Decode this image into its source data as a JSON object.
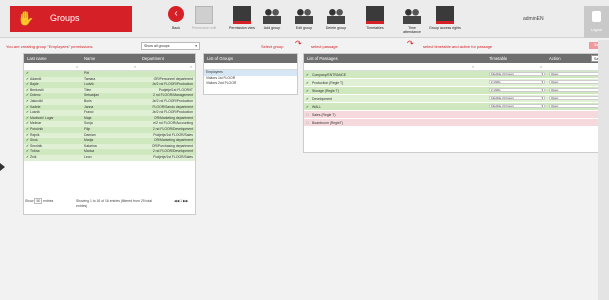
{
  "app": {
    "title": "Groups",
    "user": "adminEN",
    "logout": "Logout"
  },
  "toolbar": [
    {
      "name": "back-button",
      "label": "Back",
      "icon": "back-arrow-icon",
      "disabled": false
    },
    {
      "name": "permission-edit-button",
      "label": "Permission edit",
      "icon": "permission-edit-icon",
      "disabled": true
    },
    {
      "name": "permission-view-button",
      "label": "Permission view",
      "icon": "permission-view-icon",
      "disabled": false
    },
    {
      "name": "add-group-button",
      "label": "Add group",
      "icon": "add-group-icon",
      "disabled": false
    },
    {
      "name": "edit-group-button",
      "label": "Edit group",
      "icon": "edit-group-icon",
      "disabled": false
    },
    {
      "name": "delete-group-button",
      "label": "Delete group",
      "icon": "delete-group-icon",
      "disabled": false
    },
    {
      "name": "timetables-button",
      "label": "Timetables",
      "icon": "timetables-icon",
      "disabled": false
    },
    {
      "name": "time-attendance-button",
      "label": "Time attendance",
      "icon": "time-attendance-icon",
      "disabled": false
    },
    {
      "name": "group-access-rights-button",
      "label": "Group access rights",
      "icon": "group-access-rights-icon",
      "disabled": false
    }
  ],
  "hints": {
    "editing": "You are creating group \"Employees\" permissions",
    "select_group": "Select group",
    "select_passage": "select passage",
    "select_timetable": "select timetable and active for passage"
  },
  "show_groups": {
    "value": "Show all groups"
  },
  "save_label": "Save",
  "people": {
    "headers": [
      "Last name",
      "Name",
      "Department"
    ],
    "rows": [
      [
        "",
        "Pitt",
        ""
      ],
      [
        "Adamič",
        "Tamara",
        "OR/Personnel department"
      ],
      [
        "Bajde",
        "Ludvik",
        "Je/2 nd FLOOR/Production"
      ],
      [
        "Benkovič",
        "Tilen",
        "Podjetje/1st FLOOR/IT"
      ],
      [
        "Dolenc",
        "Sebastjan",
        "2 nd FLOOR/Management"
      ],
      [
        "Jakovčič",
        "Boris",
        "Je/2 nd FLOOR/Production"
      ],
      [
        "Kadele",
        "Janna",
        "FLOOR/Sandu department"
      ],
      [
        "Lusnik",
        "Franci",
        "Je/2 nd FLOOR/Production"
      ],
      [
        "Mariborič Logar",
        "Maja",
        "OR/Marketing department"
      ],
      [
        "Mežnar",
        "Sonja",
        "e/2 nd FLOOR/Accounting"
      ],
      [
        "Potočnik",
        "Filip",
        "2 nd FLOOR/Development"
      ],
      [
        "Rajnik",
        "Damian",
        "Podjetje/1st FLOOR/Sales"
      ],
      [
        "Sirok",
        "Marija",
        "OR/Marketing department"
      ],
      [
        "Smolnik",
        "Katarina",
        "OR/Purchasing department"
      ],
      [
        "Trdina",
        "Marica",
        "2 nd FLOOR/Development"
      ],
      [
        "Žnik",
        "Leon",
        "Podjetje/1st FLOOR/Sales"
      ]
    ],
    "show_label": "Show",
    "entries_value": "50",
    "entries_label": "entries",
    "info": "Showing 1 to 16 of 16 entries (filtered from 29 total entries)",
    "pager": "◀◀ 1 ▶▶"
  },
  "groups": {
    "header": "List of Groups",
    "items": [
      "Employees",
      "Visitors 1st FLOOR",
      "Visitors 2nd FLOOR"
    ]
  },
  "passages": {
    "headers": [
      "List of Passages",
      "Timetable",
      "Action"
    ],
    "rows": [
      {
        "name": "Company/ENTRANCE",
        "timetable": "Flexible 24 hours",
        "action": "Open",
        "state": "on"
      },
      {
        "name": "Production (Regle T)",
        "timetable": "2 shifts",
        "action": "Open",
        "state": "on"
      },
      {
        "name": "Storage (Regle T)",
        "timetable": "2 shifts",
        "action": "Open",
        "state": "on"
      },
      {
        "name": "Development",
        "timetable": "Flexible 24 hours",
        "action": "Open",
        "state": "on"
      },
      {
        "name": "WALL",
        "timetable": "Flexible 24 hours",
        "action": "Open",
        "state": "on"
      },
      {
        "name": "Sales (Regle T)",
        "timetable": "",
        "action": "",
        "state": "off"
      },
      {
        "name": "Boardroom (RegleT)",
        "timetable": "",
        "action": "",
        "state": "off"
      }
    ]
  },
  "colors": {
    "brand": "#d62027",
    "header": "#6e6e6e",
    "selected_row": "#cfe8c0",
    "disabled_row": "#f6d9dc"
  }
}
